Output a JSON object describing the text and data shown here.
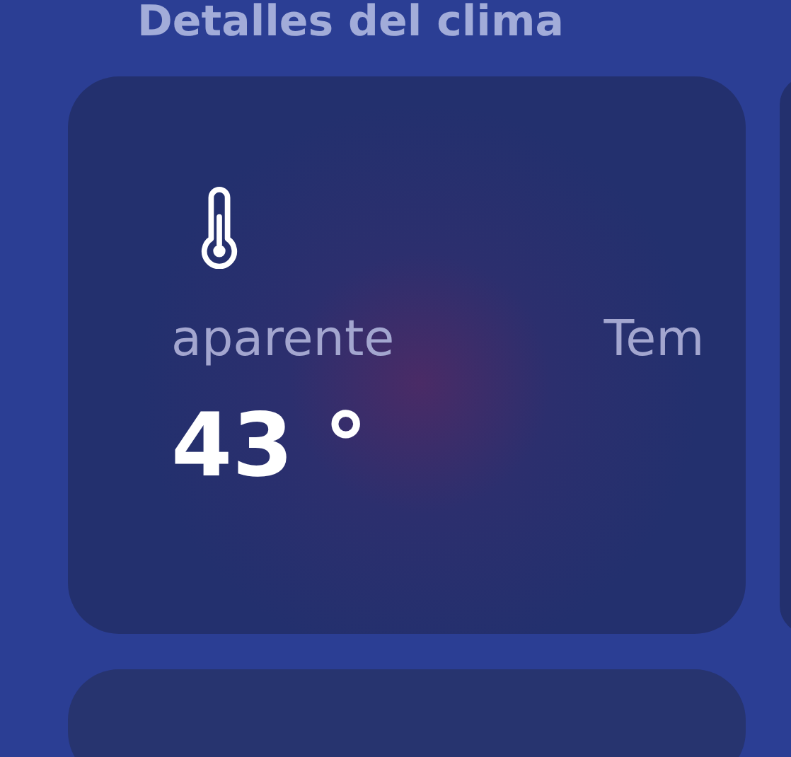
{
  "section": {
    "title": "Detalles del clima"
  },
  "card": {
    "items": [
      {
        "label": "aparente",
        "value": "43 °"
      },
      {
        "label": "Tem"
      }
    ]
  }
}
